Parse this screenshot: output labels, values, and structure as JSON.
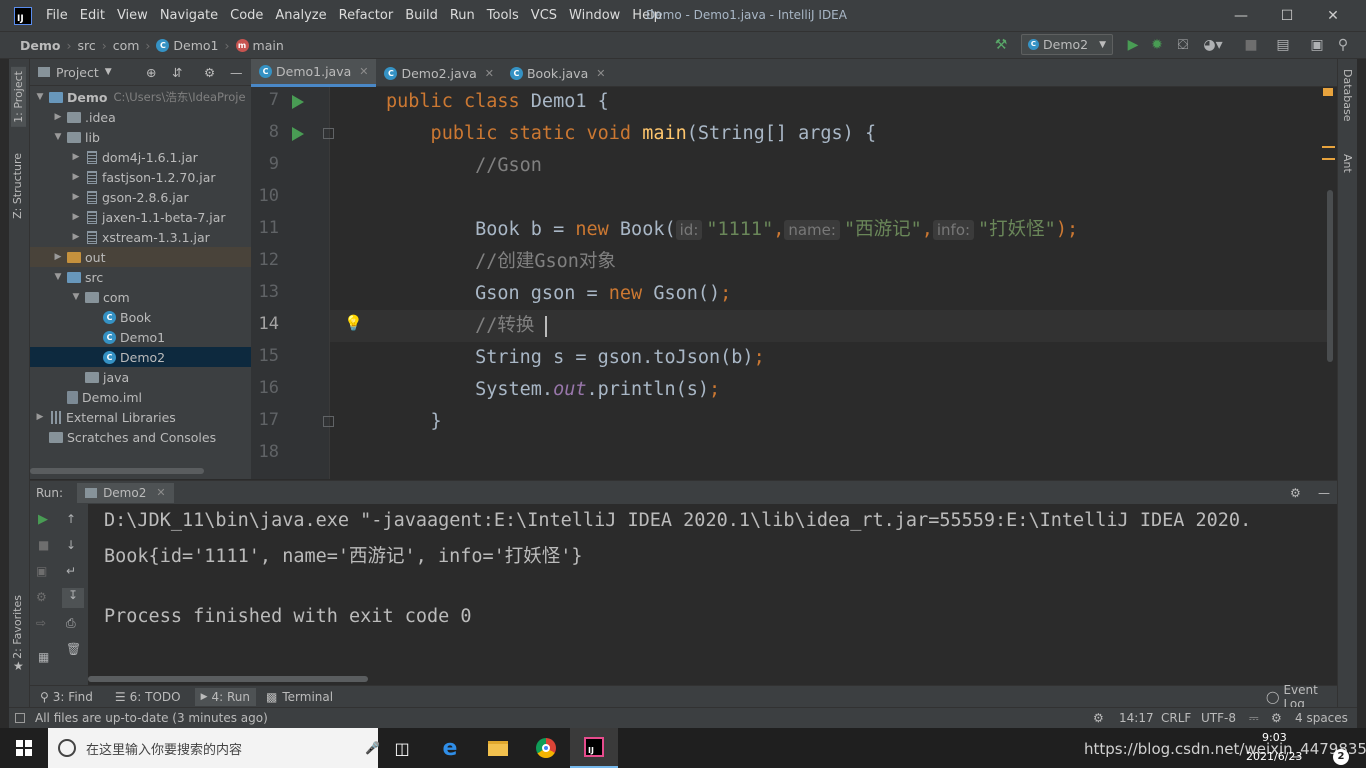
{
  "window": {
    "title": "Demo - Demo1.java - IntelliJ IDEA",
    "menu": [
      "File",
      "Edit",
      "View",
      "Navigate",
      "Code",
      "Analyze",
      "Refactor",
      "Build",
      "Run",
      "Tools",
      "VCS",
      "Window",
      "Help"
    ],
    "logo_text": "IJ"
  },
  "breadcrumb": {
    "project": "Demo",
    "src": "src",
    "pkg": "com",
    "cls": "Demo1",
    "method": "main"
  },
  "toolbar": {
    "run_config": "Demo2"
  },
  "tool_windows": {
    "left": [
      "1: Project",
      "Z: Structure",
      "2: Favorites"
    ],
    "right": [
      "Database",
      "Ant"
    ]
  },
  "project": {
    "header": "Project",
    "tree": [
      {
        "label": "Demo",
        "extra": "C:\\Users\\浩东\\IdeaProje",
        "kind": "folder-blue",
        "depth": 0,
        "arrow": "▼"
      },
      {
        "label": ".idea",
        "kind": "folder",
        "depth": 1,
        "arrow": "▶"
      },
      {
        "label": "lib",
        "kind": "folder",
        "depth": 1,
        "arrow": "▼"
      },
      {
        "label": "dom4j-1.6.1.jar",
        "kind": "jar",
        "depth": 2,
        "arrow": "▶"
      },
      {
        "label": "fastjson-1.2.70.jar",
        "kind": "jar",
        "depth": 2,
        "arrow": "▶"
      },
      {
        "label": "gson-2.8.6.jar",
        "kind": "jar",
        "depth": 2,
        "arrow": "▶"
      },
      {
        "label": "jaxen-1.1-beta-7.jar",
        "kind": "jar",
        "depth": 2,
        "arrow": "▶"
      },
      {
        "label": "xstream-1.3.1.jar",
        "kind": "jar",
        "depth": 2,
        "arrow": "▶"
      },
      {
        "label": "out",
        "kind": "folder-orange",
        "depth": 1,
        "arrow": "▶",
        "state": "hl"
      },
      {
        "label": "src",
        "kind": "folder-blue",
        "depth": 1,
        "arrow": "▼"
      },
      {
        "label": "com",
        "kind": "folder",
        "depth": 2,
        "arrow": "▼"
      },
      {
        "label": "Book",
        "kind": "class",
        "depth": 3,
        "arrow": ""
      },
      {
        "label": "Demo1",
        "kind": "class",
        "depth": 3,
        "arrow": ""
      },
      {
        "label": "Demo2",
        "kind": "class",
        "depth": 3,
        "arrow": "",
        "state": "sel"
      },
      {
        "label": "java",
        "kind": "folder",
        "depth": 2,
        "arrow": ""
      },
      {
        "label": "Demo.iml",
        "kind": "file",
        "depth": 1,
        "arrow": ""
      },
      {
        "label": "External Libraries",
        "kind": "lib",
        "depth": 0,
        "arrow": "▶"
      },
      {
        "label": "Scratches and Consoles",
        "kind": "scratch",
        "depth": 0,
        "arrow": ""
      }
    ]
  },
  "tabs": [
    {
      "label": "Demo1.java",
      "active": true
    },
    {
      "label": "Demo2.java",
      "active": false
    },
    {
      "label": "Book.java",
      "active": false
    }
  ],
  "editor": {
    "line_numbers": [
      "7",
      "8",
      "9",
      "10",
      "11",
      "12",
      "13",
      "14",
      "15",
      "16",
      "17",
      "18"
    ],
    "lines": {
      "l7a": "public class ",
      "l7b": "Demo1 {",
      "l8a": "    public static void ",
      "l8b": "main",
      "l8c": "(String[] args) {",
      "l9": "        //Gson",
      "l11a": "        Book b = ",
      "l11b": "new ",
      "l11c": "Book(",
      "h_id": "id:",
      "s_id": "\"1111\"",
      "h_name": "name:",
      "s_name": "\"西游记\"",
      "h_info": "info:",
      "s_info": "\"打妖怪\"",
      "l11end": ");",
      "l12": "        //创建Gson对象",
      "l13a": "        Gson gson = ",
      "l13b": "new ",
      "l13c": "Gson()",
      "l13d": ";",
      "l14": "        //转换",
      "l15a": "        String s = gson.toJson(b)",
      "l15b": ";",
      "l16a": "        System.",
      "l16b": "out",
      "l16c": ".println(s)",
      "l16d": ";",
      "l17": "    }"
    }
  },
  "run": {
    "label": "Run:",
    "tab": "Demo2",
    "console": [
      "D:\\JDK_11\\bin\\java.exe \"-javaagent:E:\\IntelliJ IDEA 2020.1\\lib\\idea_rt.jar=55559:E:\\IntelliJ IDEA 2020.",
      "Book{id='1111', name='西游记', info='打妖怪'}",
      "",
      "Process finished with exit code 0"
    ]
  },
  "bottom_tabs": [
    "3: Find",
    "6: TODO",
    "4: Run",
    "Terminal"
  ],
  "event_log": "Event Log",
  "status": {
    "message": "All files are up-to-date (3 minutes ago)",
    "position": "14:17",
    "line_sep": "CRLF",
    "encoding": "UTF-8",
    "indent": "4 spaces"
  },
  "taskbar": {
    "search_placeholder": "在这里输入你要搜索的内容",
    "time": "9:03",
    "date": "2021/6/23",
    "watermark": "https://blog.csdn.net/weixin_44798354",
    "badge": "2"
  },
  "colors": {
    "accent": "#4a88c7",
    "run_green": "#499c54",
    "keyword": "#cc7832",
    "string": "#6a8759"
  }
}
